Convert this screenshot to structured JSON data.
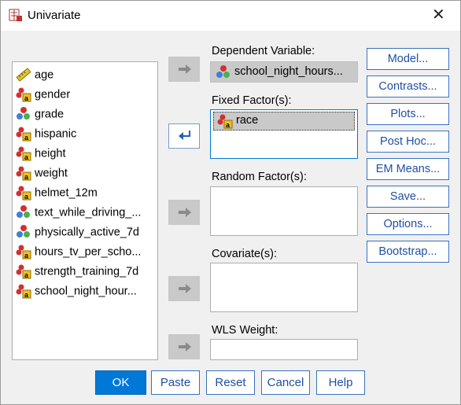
{
  "window": {
    "title": "Univariate",
    "close_glyph": "✕"
  },
  "variables": [
    {
      "label": "age",
      "icon": "ruler-scale-icon"
    },
    {
      "label": "gender",
      "icon": "nominal-variable-icon"
    },
    {
      "label": "grade",
      "icon": "ordinal-variable-icon"
    },
    {
      "label": "hispanic",
      "icon": "nominal-variable-icon"
    },
    {
      "label": "height",
      "icon": "nominal-variable-icon"
    },
    {
      "label": "weight",
      "icon": "nominal-variable-icon"
    },
    {
      "label": "helmet_12m",
      "icon": "nominal-variable-icon"
    },
    {
      "label": "text_while_driving_...",
      "icon": "ordinal-variable-icon"
    },
    {
      "label": "physically_active_7d",
      "icon": "ordinal-variable-icon"
    },
    {
      "label": "hours_tv_per_scho...",
      "icon": "nominal-variable-icon"
    },
    {
      "label": "strength_training_7d",
      "icon": "nominal-variable-icon"
    },
    {
      "label": "school_night_hour...",
      "icon": "nominal-variable-icon"
    }
  ],
  "dependent": {
    "label": "Dependent Variable:",
    "value": "school_night_hours..."
  },
  "fixed": {
    "label": "Fixed Factor(s):",
    "items": [
      "race"
    ]
  },
  "random": {
    "label": "Random Factor(s):"
  },
  "covariate": {
    "label": "Covariate(s):"
  },
  "wls": {
    "label": "WLS Weight:"
  },
  "side_buttons": [
    "Model...",
    "Contrasts...",
    "Plots...",
    "Post Hoc...",
    "EM Means...",
    "Save...",
    "Options...",
    "Bootstrap..."
  ],
  "bottom_buttons": {
    "ok": "OK",
    "paste": "Paste",
    "reset": "Reset",
    "cancel": "Cancel",
    "help": "Help"
  },
  "colors": {
    "accent": "#0078d7",
    "button_text": "#1f4fa3",
    "disabled": "#c9c9c9"
  }
}
